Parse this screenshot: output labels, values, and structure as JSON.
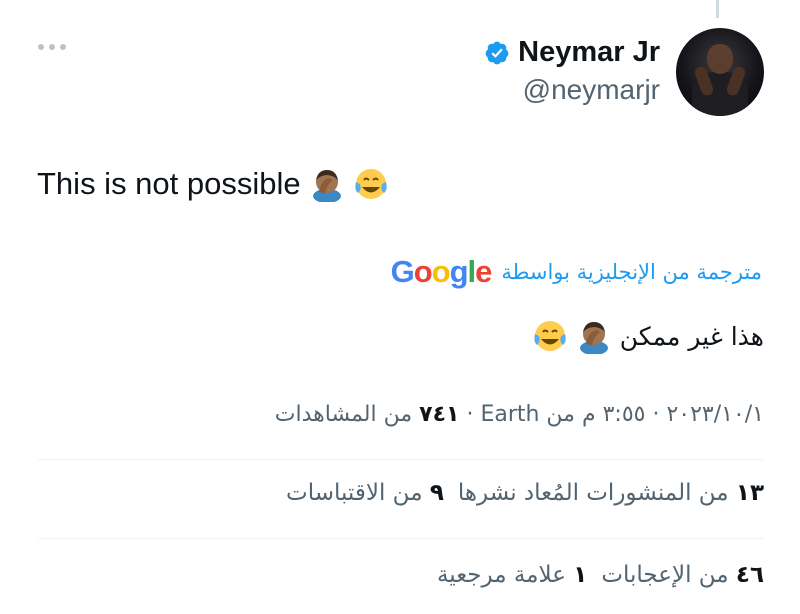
{
  "author": {
    "display_name": "Neymar Jr",
    "handle": "@neymarjr",
    "verified": true,
    "avatar_icon": "avatar-photo"
  },
  "tweet": {
    "text": "This is not possible",
    "emojis": [
      "face-palm-emoji",
      "tears-of-joy-emoji"
    ]
  },
  "translation": {
    "label": "مترجمة من الإنجليزية بواسطة",
    "provider": "Google",
    "text": "هذا غير ممكن"
  },
  "meta": {
    "date": "٢٠٢٣/١٠/١",
    "time": "٣:٥٥ م",
    "location": "من Earth",
    "views": "٧٤١",
    "views_label": "من المشاهدات"
  },
  "stats": {
    "reposts_count": "١٣",
    "reposts_label": "من المنشورات المُعاد نشرها",
    "quotes_count": "٩",
    "quotes_label": "من الاقتباسات",
    "likes_count": "٤٦",
    "likes_label": "من الإعجابات",
    "bookmarks_count": "١",
    "bookmarks_label": "علامة مرجعية"
  },
  "colors": {
    "accent": "#1d9bf0",
    "text": "#0f1419",
    "secondary": "#536471"
  }
}
